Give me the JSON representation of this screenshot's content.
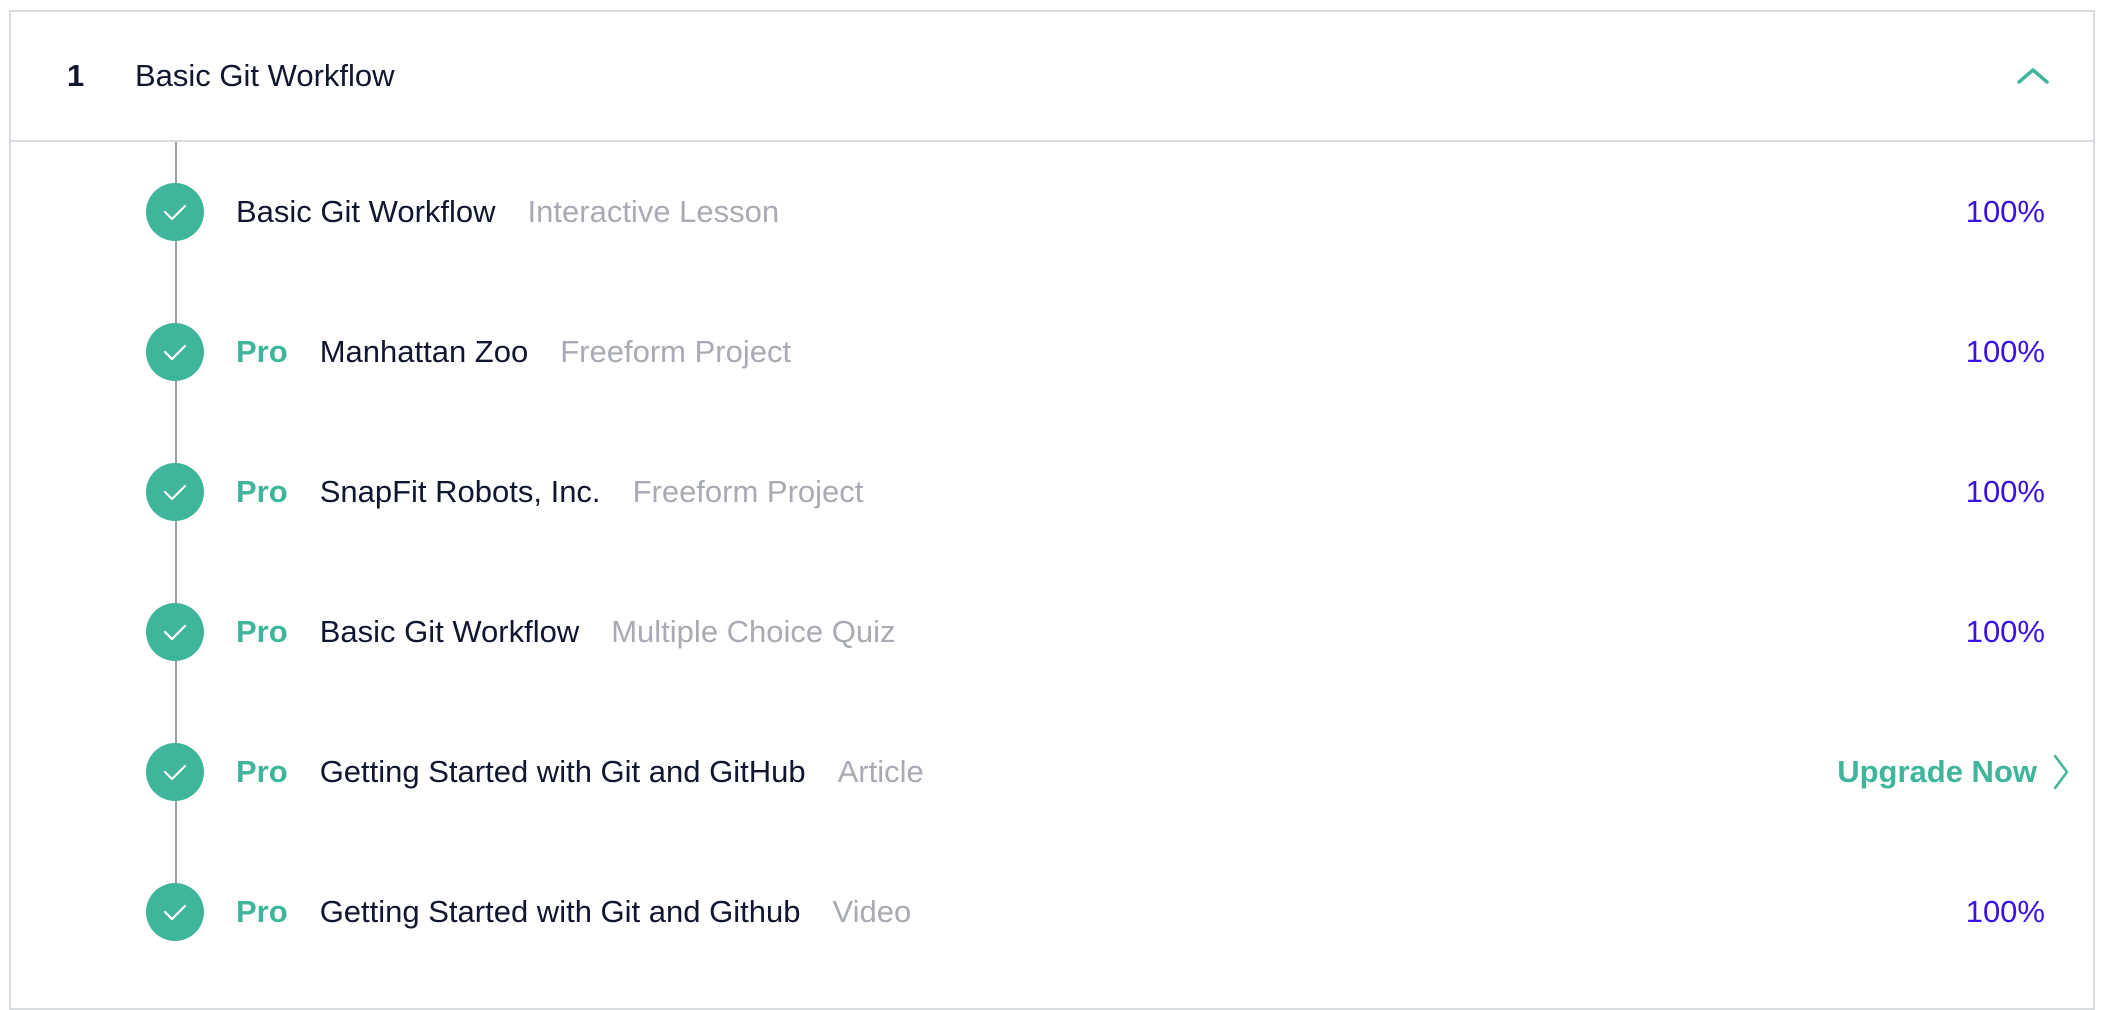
{
  "module": {
    "number": "1",
    "title": "Basic Git Workflow",
    "toggle_icon": "chevron-up-icon"
  },
  "items": [
    {
      "pro": "",
      "title": "Basic Git Workflow",
      "type": "Interactive Lesson",
      "status": "100%",
      "completed": true
    },
    {
      "pro": "Pro",
      "title": "Manhattan Zoo",
      "type": "Freeform Project",
      "status": "100%",
      "completed": true
    },
    {
      "pro": "Pro",
      "title": "SnapFit Robots, Inc.",
      "type": "Freeform Project",
      "status": "100%",
      "completed": true
    },
    {
      "pro": "Pro",
      "title": "Basic Git Workflow",
      "type": "Multiple Choice Quiz",
      "status": "100%",
      "completed": true
    },
    {
      "pro": "Pro",
      "title": "Getting Started with Git and GitHub",
      "type": "Article",
      "status": "Upgrade Now",
      "completed": true
    },
    {
      "pro": "Pro",
      "title": "Getting Started with Git and Github",
      "type": "Video",
      "status": "100%",
      "completed": true
    }
  ],
  "colors": {
    "accent_green": "#3fb59b",
    "progress_purple": "#3a10e5",
    "text_dark": "#10162f",
    "text_muted": "#a8abb3"
  }
}
